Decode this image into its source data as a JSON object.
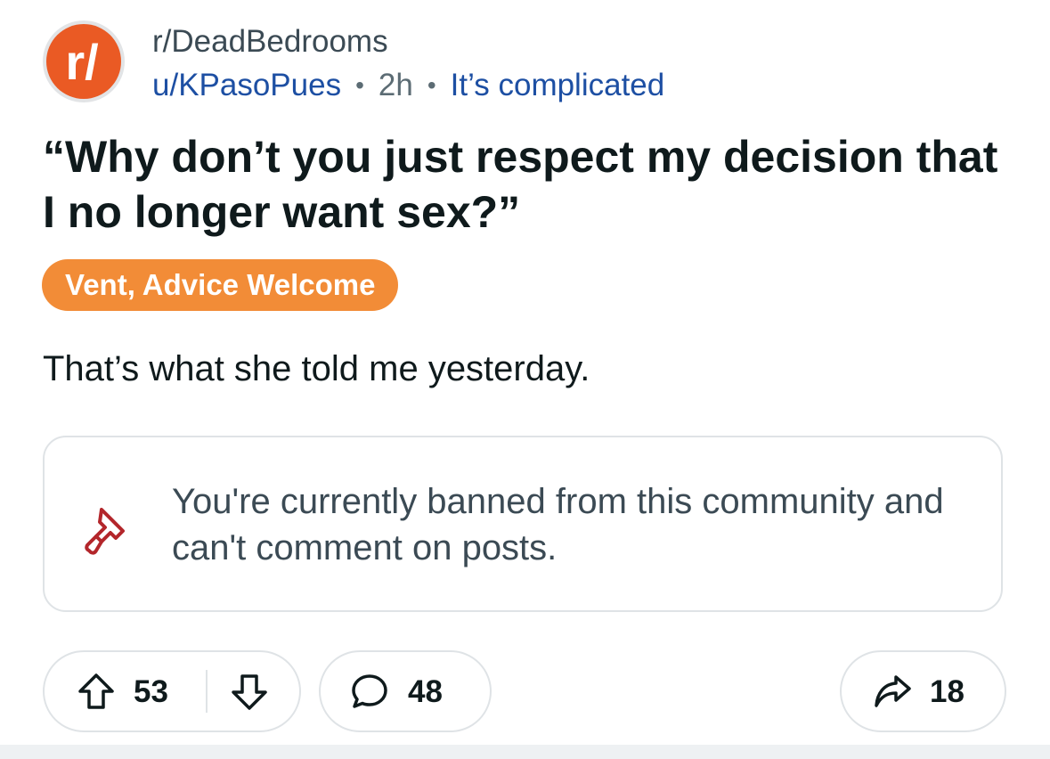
{
  "post": {
    "subreddit": "r/DeadBedrooms",
    "author": "u/KPasoPues",
    "separator": "•",
    "age": "2h",
    "user_flair": "It’s complicated",
    "title": "“Why don’t you just respect my decision that I no longer want sex?”",
    "post_flair": "Vent, Advice Welcome",
    "body": "That’s what she told me yesterday."
  },
  "ban_notice": {
    "text": "You're currently banned from this community and can't comment on posts."
  },
  "actions": {
    "upvotes": "53",
    "comments": "48",
    "shares": "18"
  },
  "colors": {
    "subreddit_icon": "#ea5a24",
    "flair_bg": "#f28c37",
    "link_blue": "#1d4fa3",
    "ban_icon": "#b3262b"
  },
  "icons": {
    "subreddit": "subreddit-logo-icon",
    "ban": "hammer-icon",
    "upvote": "upvote-arrow-icon",
    "downvote": "downvote-arrow-icon",
    "comment": "comment-bubble-icon",
    "share": "share-arrow-icon"
  }
}
